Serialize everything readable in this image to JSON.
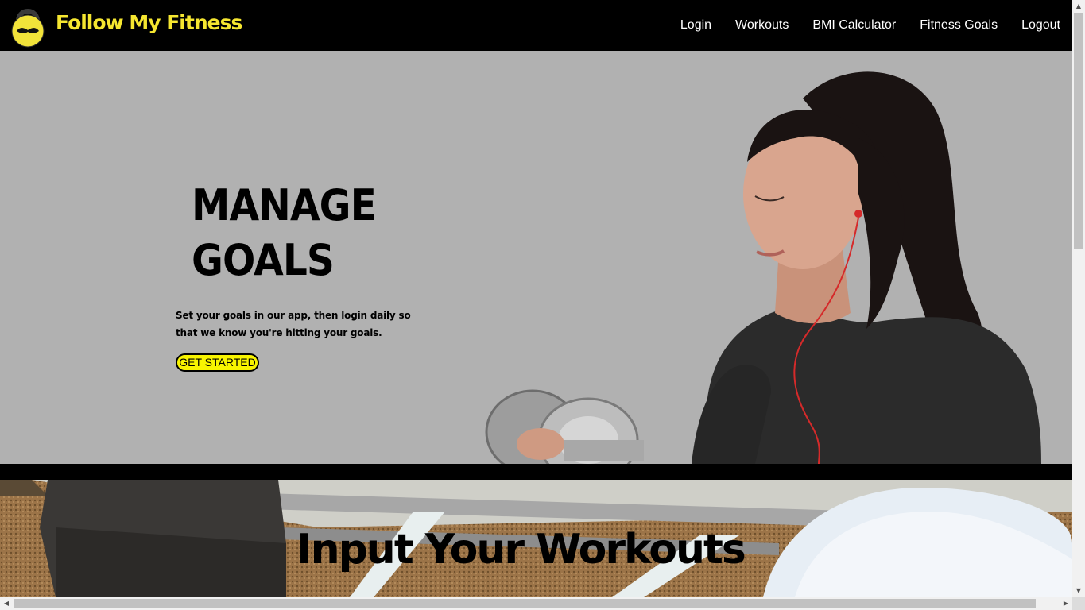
{
  "header": {
    "brand": "Follow My Fitness",
    "nav": [
      {
        "label": "Login"
      },
      {
        "label": "Workouts"
      },
      {
        "label": "BMI Calculator"
      },
      {
        "label": "Fitness Goals"
      },
      {
        "label": "Logout"
      }
    ]
  },
  "hero": {
    "title_line1": "MANAGE",
    "title_line2": "GOALS",
    "text": "Set your goals in our app, then login daily so that we know you're hitting your goals.",
    "cta": "GET STARTED"
  },
  "workouts": {
    "title": "Input Your Workouts"
  },
  "icons": {
    "logo": "kettlebell-mustache-icon",
    "scroll_up": "arrow-up-icon",
    "scroll_down": "arrow-down-icon",
    "scroll_left": "arrow-left-icon",
    "scroll_right": "arrow-right-icon"
  },
  "colors": {
    "header_bg": "#000000",
    "brand": "#f5e630",
    "hero_bg": "#b1b1b1",
    "cta_bg": "#f8f400"
  }
}
